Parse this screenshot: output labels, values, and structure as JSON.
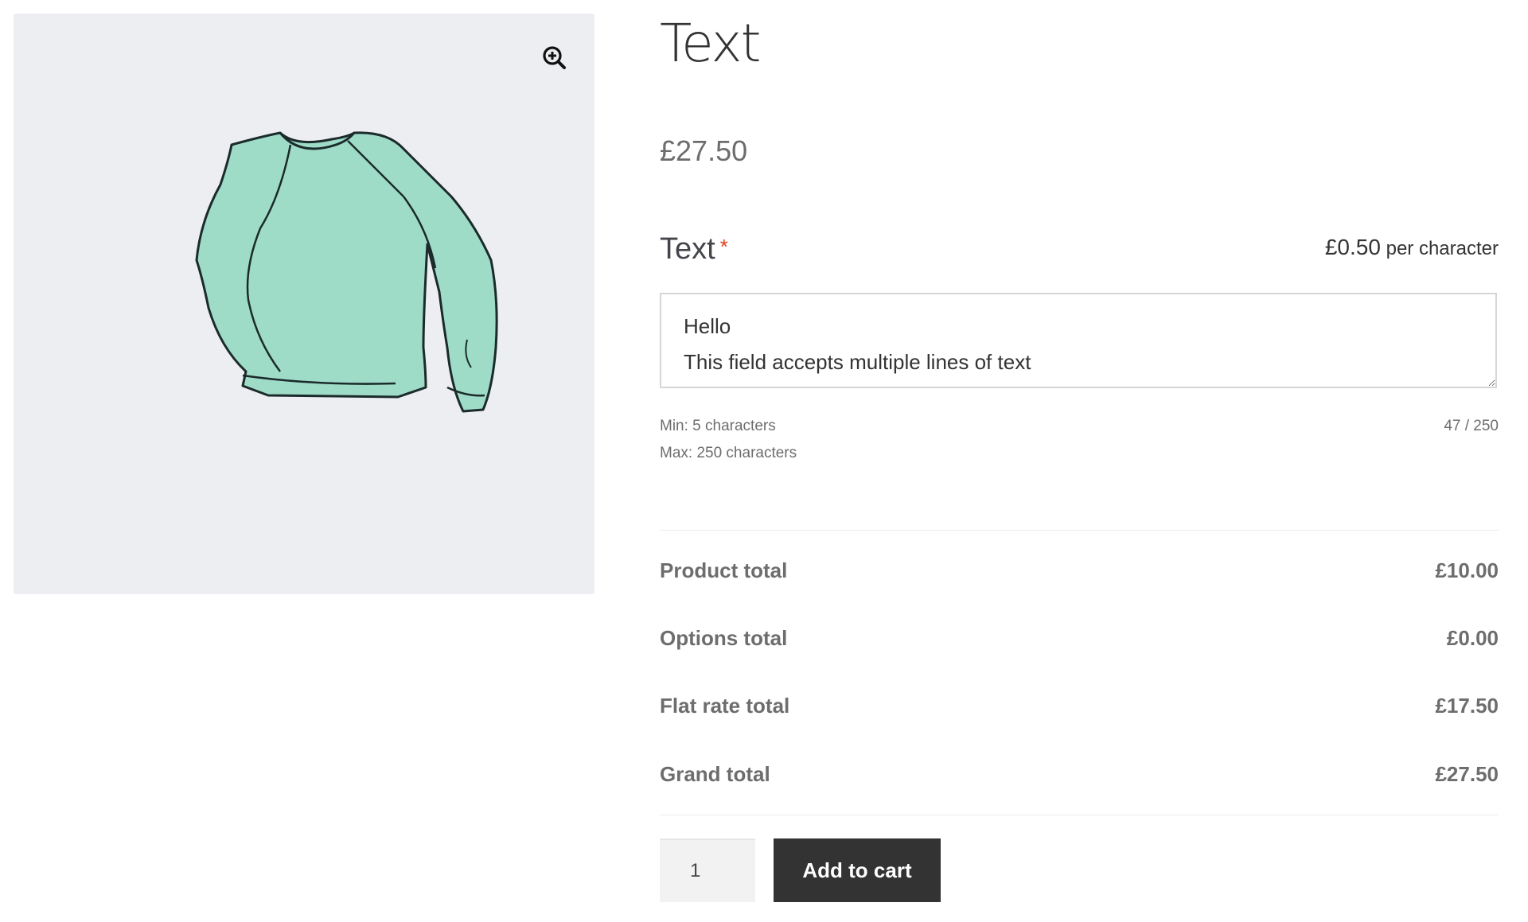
{
  "product": {
    "title": "Text",
    "price": "£27.50"
  },
  "addon": {
    "label": "Text",
    "required_mark": "*",
    "price_amount": "£0.50",
    "price_unit": "per character",
    "value": "Hello\nThis field accepts multiple lines of text",
    "min_hint": "Min: 5 characters",
    "max_hint": "Max: 250 characters",
    "char_count": "47 / 250"
  },
  "totals": [
    {
      "label": "Product total",
      "value": "£10.00"
    },
    {
      "label": "Options total",
      "value": "£0.00"
    },
    {
      "label": "Flat rate total",
      "value": "£17.50"
    },
    {
      "label": "Grand total",
      "value": "£27.50"
    }
  ],
  "cart": {
    "quantity": "1",
    "add_label": "Add to cart"
  },
  "colors": {
    "gallery_bg": "#eceef1",
    "sweater": "#9fdcc8",
    "button_bg": "#333333",
    "required": "#e2401c"
  },
  "icons": {
    "zoom": "zoom-in-icon",
    "resize": "resize-grip-icon"
  }
}
